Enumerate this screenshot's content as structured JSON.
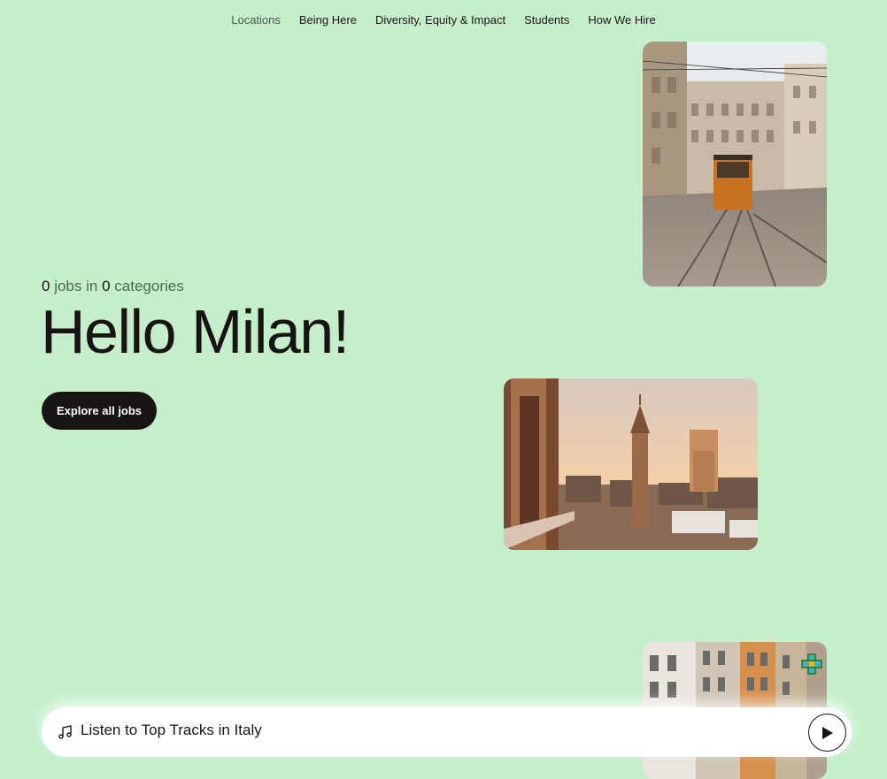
{
  "nav": {
    "items": [
      {
        "label": "Locations",
        "active": true
      },
      {
        "label": "Being Here"
      },
      {
        "label": "Diversity, Equity & Impact"
      },
      {
        "label": "Students"
      },
      {
        "label": "How We Hire"
      }
    ]
  },
  "hero": {
    "jobs_count": "0",
    "jobs_text": "jobs in",
    "categories_count": "0",
    "categories_text": "categories",
    "title": "Hello Milan!",
    "cta_label": "Explore all jobs"
  },
  "player": {
    "icon": "music-note-icon",
    "label": "Listen to Top Tracks in Italy",
    "play_icon": "play-icon"
  },
  "colors": {
    "background": "#c5efcb",
    "text": "#191414",
    "button": "#191414",
    "muted": "#4b6b50"
  }
}
